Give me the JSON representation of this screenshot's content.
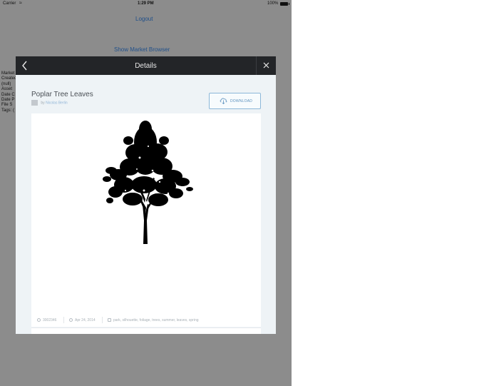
{
  "status_bar": {
    "carrier": "Carrier",
    "time": "1:29 PM",
    "battery": "100%"
  },
  "background": {
    "logout_label": "Logout",
    "market_browser_label": "Show Market Browser",
    "meta_lines": [
      "Market",
      "Created",
      " (null)",
      "Asset",
      "Date C",
      "Date P",
      "File S",
      "Tags: ("
    ]
  },
  "modal": {
    "title": "Details",
    "asset_title": "Poplar Tree Leaves",
    "byline_prefix": "by",
    "author": "Nicolas Berlin",
    "download_label": "DOWNLOAD",
    "meta": {
      "file_id": "3002346",
      "date": "Apr 24, 2014",
      "tags": "park, silhouette, foliage, trees, summer, leaves, spring"
    }
  },
  "colors": {
    "header_bg": "#232528",
    "accent": "#5b90bd",
    "overlay": "#8c8c8c"
  }
}
